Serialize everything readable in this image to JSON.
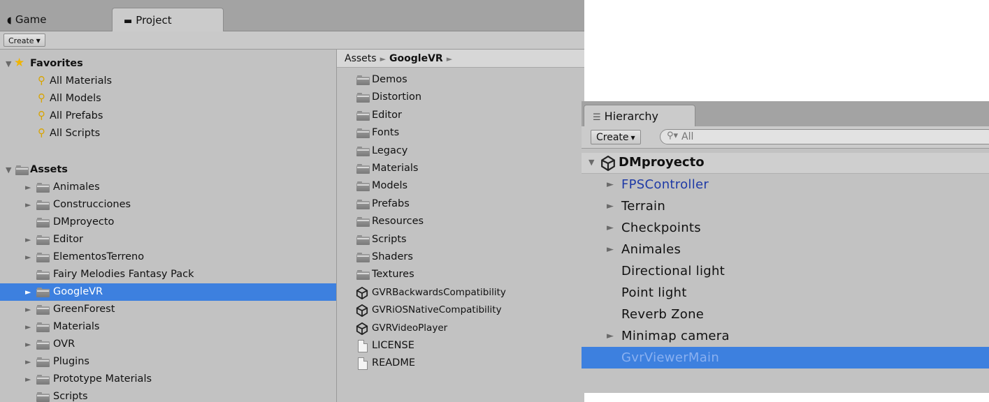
{
  "project": {
    "tabs": [
      {
        "label": "Game",
        "icon": "pacman-icon"
      },
      {
        "label": "Project",
        "icon": "folder-icon"
      }
    ],
    "create_label": "Create",
    "tree": [
      {
        "label": "Favorites",
        "kind": "favorites-header",
        "expanded": true
      },
      {
        "label": "All Materials",
        "kind": "search"
      },
      {
        "label": "All Models",
        "kind": "search"
      },
      {
        "label": "All Prefabs",
        "kind": "search"
      },
      {
        "label": "All Scripts",
        "kind": "search"
      },
      {
        "label": "Assets",
        "kind": "assets-header",
        "expanded": true
      },
      {
        "label": "Animales",
        "kind": "folder",
        "arrow": true
      },
      {
        "label": "Construcciones",
        "kind": "folder",
        "arrow": true
      },
      {
        "label": "DMproyecto",
        "kind": "folder",
        "arrow": false
      },
      {
        "label": "Editor",
        "kind": "folder",
        "arrow": true
      },
      {
        "label": "ElementosTerreno",
        "kind": "folder",
        "arrow": true
      },
      {
        "label": "Fairy Melodies Fantasy Pack",
        "kind": "folder",
        "arrow": false
      },
      {
        "label": "GoogleVR",
        "kind": "folder",
        "arrow": true,
        "selected": true
      },
      {
        "label": "GreenForest",
        "kind": "folder",
        "arrow": true
      },
      {
        "label": "Materials",
        "kind": "folder",
        "arrow": true
      },
      {
        "label": "OVR",
        "kind": "folder",
        "arrow": true
      },
      {
        "label": "Plugins",
        "kind": "folder",
        "arrow": true
      },
      {
        "label": "Prototype Materials",
        "kind": "folder",
        "arrow": true
      },
      {
        "label": "Scripts",
        "kind": "folder",
        "arrow": false
      }
    ],
    "breadcrumb": {
      "root": "Assets",
      "current": "GoogleVR"
    },
    "contents": [
      {
        "label": "Demos",
        "kind": "folder"
      },
      {
        "label": "Distortion",
        "kind": "folder"
      },
      {
        "label": "Editor",
        "kind": "folder"
      },
      {
        "label": "Fonts",
        "kind": "folder"
      },
      {
        "label": "Legacy",
        "kind": "folder"
      },
      {
        "label": "Materials",
        "kind": "folder"
      },
      {
        "label": "Models",
        "kind": "folder"
      },
      {
        "label": "Prefabs",
        "kind": "folder"
      },
      {
        "label": "Resources",
        "kind": "folder"
      },
      {
        "label": "Scripts",
        "kind": "folder"
      },
      {
        "label": "Shaders",
        "kind": "folder"
      },
      {
        "label": "Textures",
        "kind": "folder"
      },
      {
        "label": "GVRBackwardsCompatibility",
        "kind": "scene"
      },
      {
        "label": "GVRiOSNativeCompatibility",
        "kind": "scene"
      },
      {
        "label": "GVRVideoPlayer",
        "kind": "scene"
      },
      {
        "label": "LICENSE",
        "kind": "file"
      },
      {
        "label": "README",
        "kind": "file"
      }
    ]
  },
  "hierarchy": {
    "tab_label": "Hierarchy",
    "create_label": "Create",
    "search_placeholder": "All",
    "scene_name": "DMproyecto",
    "items": [
      {
        "label": "FPSController",
        "arrow": true,
        "prefab": true
      },
      {
        "label": "Terrain",
        "arrow": true
      },
      {
        "label": "Checkpoints",
        "arrow": true
      },
      {
        "label": "Animales",
        "arrow": true
      },
      {
        "label": "Directional light",
        "arrow": false
      },
      {
        "label": "Point light",
        "arrow": false
      },
      {
        "label": "Reverb Zone",
        "arrow": false
      },
      {
        "label": "Minimap camera",
        "arrow": true
      },
      {
        "label": "GvrViewerMain",
        "arrow": false,
        "selected": true
      }
    ]
  },
  "colors": {
    "selection": "#3d80df",
    "panel": "#c2c2c2",
    "prefab_text": "#1f3aa6"
  }
}
